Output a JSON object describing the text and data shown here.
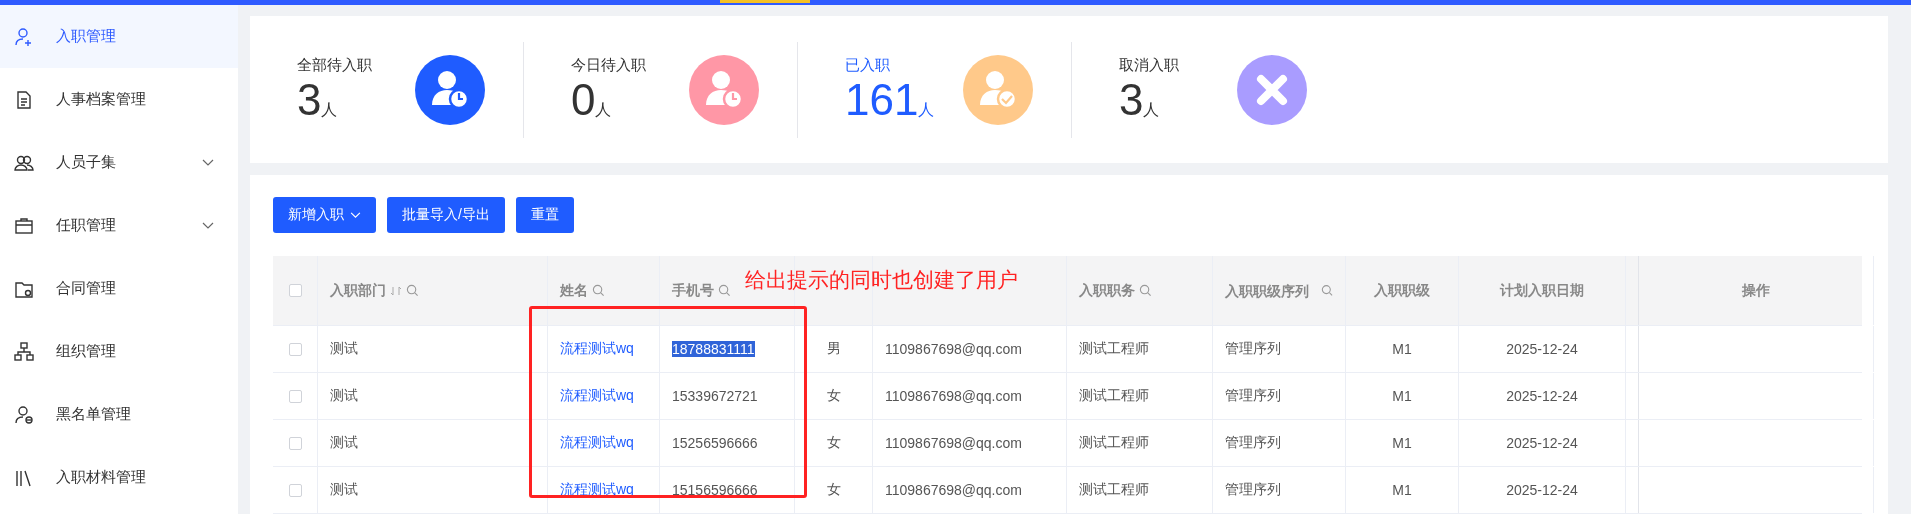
{
  "sidebar": {
    "items": [
      {
        "label": "入职管理",
        "selected": true
      },
      {
        "label": "人事档案管理",
        "selected": false
      },
      {
        "label": "人员子集",
        "selected": false,
        "expandable": true
      },
      {
        "label": "任职管理",
        "selected": false,
        "expandable": true
      },
      {
        "label": "合同管理",
        "selected": false
      },
      {
        "label": "组织管理",
        "selected": false
      },
      {
        "label": "黑名单管理",
        "selected": false
      },
      {
        "label": "入职材料管理",
        "selected": false
      }
    ]
  },
  "stats": [
    {
      "label": "全部待入职",
      "value": "3",
      "unit": "人",
      "color": "#1f5cff",
      "selected": false
    },
    {
      "label": "今日待入职",
      "value": "0",
      "unit": "人",
      "color": "#ff97a6",
      "selected": false
    },
    {
      "label": "已入职",
      "value": "161",
      "unit": "人",
      "color": "#ffc98a",
      "selected": true
    },
    {
      "label": "取消入职",
      "value": "3",
      "unit": "人",
      "color": "#a99cff",
      "selected": false
    }
  ],
  "toolbar": {
    "buttons": [
      {
        "label": "新增入职",
        "dropdown": true
      },
      {
        "label": "批量导入/导出"
      },
      {
        "label": "重置"
      }
    ]
  },
  "table": {
    "select_all": {
      "checked": false
    },
    "columns": [
      {
        "label": "入职部门",
        "sort": true,
        "search": true
      },
      {
        "label": "姓名",
        "search": true
      },
      {
        "label": "手机号",
        "search": true
      },
      {},
      {},
      {
        "label": "入职职务",
        "search": true
      },
      {
        "label": "入职职级序列",
        "search": true
      },
      {
        "label": "入职职级"
      },
      {
        "label": "计划入职日期"
      },
      {
        "label": "操作"
      }
    ],
    "rows": [
      {
        "checked": false,
        "phone_highlighted": true,
        "cells": [
          "测试",
          "流程测试wq",
          "18788831111",
          "男",
          "1109867698@qq.com",
          "测试工程师",
          "管理序列",
          "M1",
          "2025-12-24"
        ]
      },
      {
        "checked": false,
        "phone_highlighted": false,
        "cells": [
          "测试",
          "流程测试wq",
          "15339672721",
          "女",
          "1109867698@qq.com",
          "测试工程师",
          "管理序列",
          "M1",
          "2025-12-24"
        ]
      },
      {
        "checked": false,
        "phone_highlighted": false,
        "cells": [
          "测试",
          "流程测试wq",
          "15256596666",
          "女",
          "1109867698@qq.com",
          "测试工程师",
          "管理序列",
          "M1",
          "2025-12-24"
        ]
      },
      {
        "checked": false,
        "phone_highlighted": false,
        "cells": [
          "测试",
          "流程测试wq",
          "15156596666",
          "女",
          "1109867698@qq.com",
          "测试工程师",
          "管理序列",
          "M1",
          "2025-12-24"
        ]
      }
    ]
  },
  "annotation": {
    "text": "给出提示的同时也创建了用户"
  }
}
